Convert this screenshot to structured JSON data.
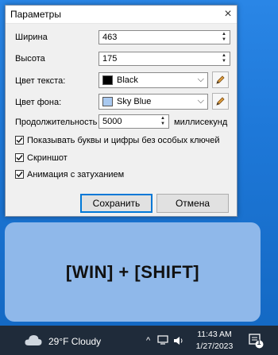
{
  "dialog": {
    "title": "Параметры",
    "width_label": "Ширина",
    "width_value": "463",
    "height_label": "Высота",
    "height_value": "175",
    "text_color_label": "Цвет текста:",
    "text_color_value": "Black",
    "text_color_hex": "#000000",
    "bg_color_label": "Цвет фона:",
    "bg_color_value": "Sky Blue",
    "bg_color_hex": "#a9c9f0",
    "duration_label": "Продолжительность",
    "duration_value": "5000",
    "duration_unit": "миллисекунд",
    "checkboxes": [
      {
        "label": "Показывать буквы и цифры без особых ключей",
        "checked": true
      },
      {
        "label": "Скриншот",
        "checked": true
      },
      {
        "label": "Анимация с затуханием",
        "checked": true
      }
    ],
    "save_label": "Сохранить",
    "cancel_label": "Отмена"
  },
  "overlay": {
    "key_text": "[WIN] + [SHIFT]",
    "bg_color": "#8fb8ea"
  },
  "taskbar": {
    "weather": "29°F Cloudy",
    "time": "11:43 AM",
    "date": "1/27/2023",
    "notification_count": "1"
  }
}
